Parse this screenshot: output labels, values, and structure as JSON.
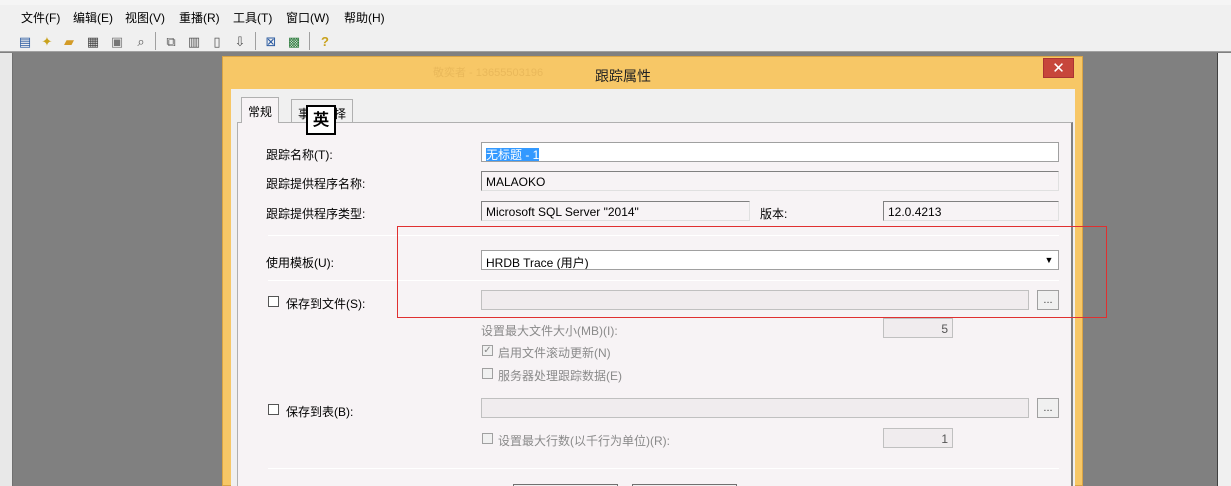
{
  "menu": [
    "文件(F)",
    "编辑(E)",
    "视图(V)",
    "重播(R)",
    "工具(T)",
    "窗口(W)",
    "帮助(H)"
  ],
  "toolbar_icons": [
    "new-trace-icon",
    "new-template-icon",
    "open-icon",
    "save-icon",
    "properties-icon",
    "find-icon",
    "replay-icon",
    "step-icon",
    "run-to-cursor-icon",
    "pause-icon",
    "stop-icon",
    "trace-properties-icon",
    "counter-icon",
    "help-icon"
  ],
  "dialog": {
    "title": "跟踪属性",
    "watermark": "敬奕者 - 13655503196",
    "close": "✕",
    "tabs": [
      "常规",
      "事件选择"
    ],
    "trace_name_label": "跟踪名称(T):",
    "trace_name_value": "无标题 - 1",
    "provider_name_label": "跟踪提供程序名称:",
    "provider_name_value": "MALAOKO",
    "ime_indicator": "英",
    "provider_type_label": "跟踪提供程序类型:",
    "provider_type_value": "Microsoft SQL Server \"2014\"",
    "version_label": "版本:",
    "version_value": "12.0.4213",
    "template_label": "使用模板(U):",
    "template_value": "HRDB Trace (用户)",
    "save_file_label": "保存到文件(S):",
    "max_file_size_label": "设置最大文件大小(MB)(I):",
    "max_file_size_value": "5",
    "file_rollover_label": "启用文件滚动更新(N)",
    "server_process_label": "服务器处理跟踪数据(E)",
    "save_table_label": "保存到表(B):",
    "max_rows_label": "设置最大行数(以千行为单位)(R):",
    "max_rows_value": "1",
    "browse": "..."
  },
  "colors": {
    "dialog_frame": "#f7c766",
    "close": "#c7463b",
    "selection": "#3399ff",
    "annotation": "#e03030"
  }
}
